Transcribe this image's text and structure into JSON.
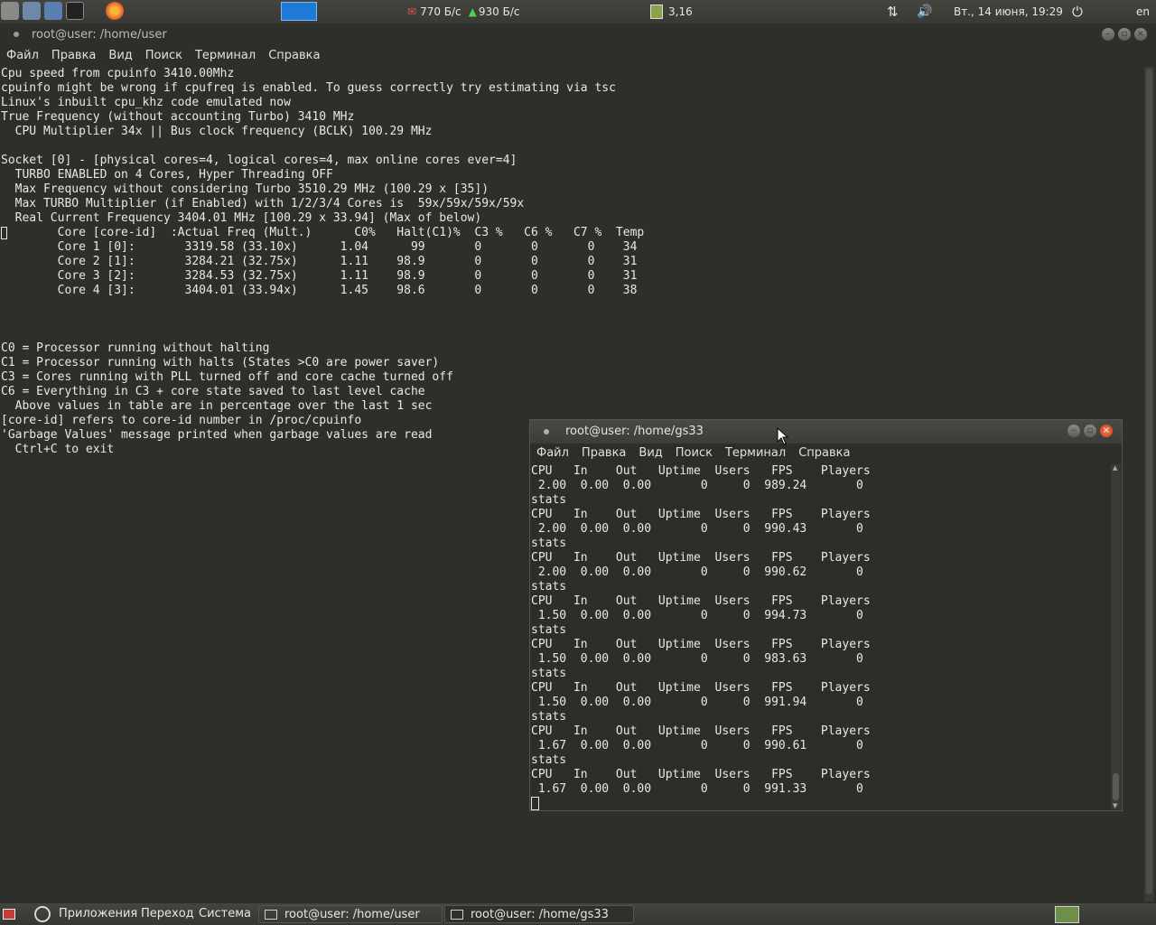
{
  "top_panel": {
    "net_down": "770 Б/с",
    "net_up": "930 Б/с",
    "load": "3,16",
    "datetime": "Вт., 14 июня, 19:29",
    "layout": "en"
  },
  "main_window": {
    "title": "root@user: /home/user",
    "menu": [
      "Файл",
      "Правка",
      "Вид",
      "Поиск",
      "Терминал",
      "Справка"
    ],
    "output": "Cpu speed from cpuinfo 3410.00Mhz\ncpuinfo might be wrong if cpufreq is enabled. To guess correctly try estimating via tsc\nLinux's inbuilt cpu_khz code emulated now\nTrue Frequency (without accounting Turbo) 3410 MHz\n  CPU Multiplier 34x || Bus clock frequency (BCLK) 100.29 MHz\n\nSocket [0] - [physical cores=4, logical cores=4, max online cores ever=4]\n  TURBO ENABLED on 4 Cores, Hyper Threading OFF\n  Max Frequency without considering Turbo 3510.29 MHz (100.29 x [35])\n  Max TURBO Multiplier (if Enabled) with 1/2/3/4 Cores is  59x/59x/59x/59x\n  Real Current Frequency 3404.01 MHz [100.29 x 33.94] (Max of below)\n        Core [core-id]  :Actual Freq (Mult.)      C0%   Halt(C1)%  C3 %   C6 %   C7 %  Temp\n        Core 1 [0]:       3319.58 (33.10x)      1.04      99       0       0       0    34\n        Core 2 [1]:       3284.21 (32.75x)      1.11    98.9       0       0       0    31\n        Core 3 [2]:       3284.53 (32.75x)      1.11    98.9       0       0       0    31\n        Core 4 [3]:       3404.01 (33.94x)      1.45    98.6       0       0       0    38\n\n\n\nC0 = Processor running without halting\nC1 = Processor running with halts (States >C0 are power saver)\nC3 = Cores running with PLL turned off and core cache turned off\nC6 = Everything in C3 + core state saved to last level cache\n  Above values in table are in percentage over the last 1 sec\n[core-id] refers to core-id number in /proc/cpuinfo\n'Garbage Values' message printed when garbage values are read\n  Ctrl+C to exit"
  },
  "gs33_window": {
    "title": "root@user: /home/gs33",
    "menu": [
      "Файл",
      "Правка",
      "Вид",
      "Поиск",
      "Терминал",
      "Справка"
    ],
    "output": "CPU   In    Out   Uptime  Users   FPS    Players\n 2.00  0.00  0.00       0     0  989.24       0\nstats\nCPU   In    Out   Uptime  Users   FPS    Players\n 2.00  0.00  0.00       0     0  990.43       0\nstats\nCPU   In    Out   Uptime  Users   FPS    Players\n 2.00  0.00  0.00       0     0  990.62       0\nstats\nCPU   In    Out   Uptime  Users   FPS    Players\n 1.50  0.00  0.00       0     0  994.73       0\nstats\nCPU   In    Out   Uptime  Users   FPS    Players\n 1.50  0.00  0.00       0     0  983.63       0\nstats\nCPU   In    Out   Uptime  Users   FPS    Players\n 1.50  0.00  0.00       0     0  991.94       0\nstats\nCPU   In    Out   Uptime  Users   FPS    Players\n 1.67  0.00  0.00       0     0  990.61       0\nstats\nCPU   In    Out   Uptime  Users   FPS    Players\n 1.67  0.00  0.00       0     0  991.33       0"
  },
  "bottom_panel": {
    "apps": "Приложения",
    "places": "Переход",
    "system": "Система",
    "task1": "root@user: /home/user",
    "task2": "root@user: /home/gs33"
  },
  "colors": {
    "panel": "#3c3c38",
    "terminal_bg": "#2e2e2b",
    "accent_blue": "#1e7ad8",
    "close_orange": "#e2562f"
  }
}
